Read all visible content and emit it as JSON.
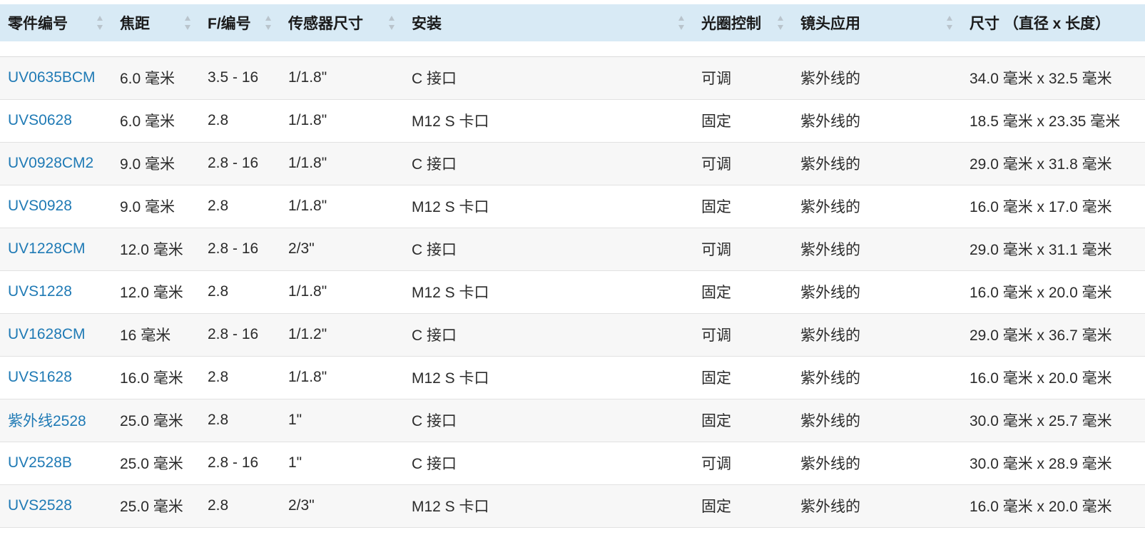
{
  "table": {
    "headers": [
      {
        "label": "零件编号",
        "sortable": true
      },
      {
        "label": "焦距",
        "sortable": true
      },
      {
        "label": "F/编号",
        "sortable": true
      },
      {
        "label": "传感器尺寸",
        "sortable": true
      },
      {
        "label": "安装",
        "sortable": true
      },
      {
        "label": "光圈控制",
        "sortable": true
      },
      {
        "label": "镜头应用",
        "sortable": true
      },
      {
        "label": "尺寸 （直径 x 长度）",
        "sortable": false
      }
    ],
    "rows": [
      {
        "part": "UV0635BCM",
        "focal": "6.0 毫米",
        "fnum": "3.5 - 16",
        "sensor": "1/1.8\"",
        "mount": "C 接口",
        "iris": "可调",
        "app": "紫外线的",
        "dims": "34.0 毫米 x 32.5 毫米"
      },
      {
        "part": "UVS0628",
        "focal": "6.0 毫米",
        "fnum": "2.8",
        "sensor": "1/1.8\"",
        "mount": "M12 S 卡口",
        "iris": "固定",
        "app": "紫外线的",
        "dims": "18.5 毫米 x 23.35 毫米"
      },
      {
        "part": "UV0928CM2",
        "focal": "9.0 毫米",
        "fnum": "2.8 - 16",
        "sensor": "1/1.8\"",
        "mount": "C 接口",
        "iris": "可调",
        "app": "紫外线的",
        "dims": "29.0 毫米 x 31.8 毫米"
      },
      {
        "part": "UVS0928",
        "focal": "9.0 毫米",
        "fnum": "2.8",
        "sensor": "1/1.8\"",
        "mount": "M12 S 卡口",
        "iris": "固定",
        "app": "紫外线的",
        "dims": "16.0 毫米 x 17.0 毫米"
      },
      {
        "part": "UV1228CM",
        "focal": "12.0 毫米",
        "fnum": "2.8 - 16",
        "sensor": "2/3\"",
        "mount": "C 接口",
        "iris": "可调",
        "app": "紫外线的",
        "dims": "29.0 毫米 x 31.1 毫米"
      },
      {
        "part": "UVS1228",
        "focal": "12.0 毫米",
        "fnum": "2.8",
        "sensor": "1/1.8\"",
        "mount": "M12 S 卡口",
        "iris": "固定",
        "app": "紫外线的",
        "dims": "16.0 毫米 x 20.0 毫米"
      },
      {
        "part": "UV1628CM",
        "focal": "16 毫米",
        "fnum": "2.8 - 16",
        "sensor": "1/1.2\"",
        "mount": "C 接口",
        "iris": "可调",
        "app": "紫外线的",
        "dims": "29.0 毫米 x 36.7 毫米"
      },
      {
        "part": "UVS1628",
        "focal": "16.0 毫米",
        "fnum": "2.8",
        "sensor": "1/1.8\"",
        "mount": "M12 S 卡口",
        "iris": "固定",
        "app": "紫外线的",
        "dims": "16.0 毫米 x 20.0 毫米"
      },
      {
        "part": "紫外线2528",
        "focal": "25.0 毫米",
        "fnum": "2.8",
        "sensor": "1\"",
        "mount": "C 接口",
        "iris": "固定",
        "app": "紫外线的",
        "dims": "30.0 毫米 x 25.7 毫米"
      },
      {
        "part": "UV2528B",
        "focal": "25.0 毫米",
        "fnum": "2.8 - 16",
        "sensor": "1\"",
        "mount": "C 接口",
        "iris": "可调",
        "app": "紫外线的",
        "dims": "30.0 毫米 x 28.9 毫米"
      },
      {
        "part": "UVS2528",
        "focal": "25.0 毫米",
        "fnum": "2.8",
        "sensor": "2/3\"",
        "mount": "M12 S 卡口",
        "iris": "固定",
        "app": "紫外线的",
        "dims": "16.0 毫米 x 20.0 毫米"
      }
    ]
  },
  "colors": {
    "header_bg": "#d8eaf5",
    "link": "#1f7ab5",
    "sort_icon": "#b9c4cc",
    "row_alt": "#f7f7f7"
  },
  "icons": {
    "sort": "sort-arrows-icon"
  }
}
